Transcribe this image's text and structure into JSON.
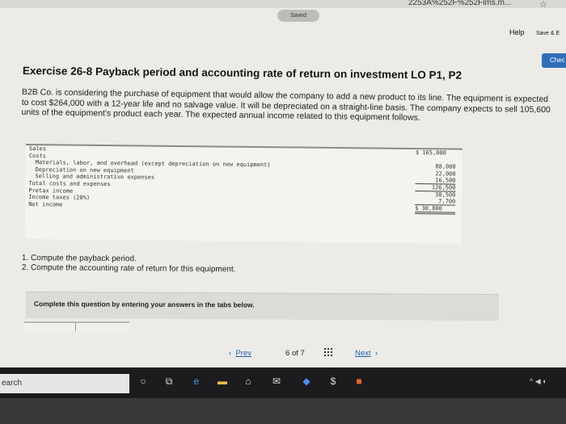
{
  "browser": {
    "url_fragment": "2253A%252F%252Flms.m...",
    "save_exit": "Save & E"
  },
  "header": {
    "saved_label": "Saved",
    "help_label": "Help",
    "check_label": "Chec"
  },
  "exercise": {
    "title": "Exercise 26-8 Payback period and accounting rate of return on investment LO P1, P2",
    "intro": "B2B Co. is considering the purchase of equipment that would allow the company to add a new product to its line. The equipment is expected to cost $264,000 with a 12-year life and no salvage value. It will be depreciated on a straight-line basis. The company expects to sell 105,600 units of the equipment's product each year. The expected annual income related to this equipment follows."
  },
  "income_statement": [
    {
      "label": "Sales",
      "amount": "$ 165,000",
      "indent": false,
      "line": ""
    },
    {
      "label": "Costs",
      "amount": "",
      "indent": false,
      "line": ""
    },
    {
      "label": "Materials, labor, and overhead (except depreciation on new equipment)",
      "amount": "88,000",
      "indent": true,
      "line": ""
    },
    {
      "label": "Depreciation on new equipment",
      "amount": "22,000",
      "indent": true,
      "line": ""
    },
    {
      "label": "Selling and administrative expenses",
      "amount": "16,500",
      "indent": true,
      "line": "under"
    },
    {
      "label": "Total costs and expenses",
      "amount": "126,500",
      "indent": false,
      "line": "under"
    },
    {
      "label": "Pretax income",
      "amount": "38,500",
      "indent": false,
      "line": ""
    },
    {
      "label": "Income taxes (20%)",
      "amount": "7,700",
      "indent": false,
      "line": "under"
    },
    {
      "label": "Net income",
      "amount": "$ 30,800",
      "indent": false,
      "line": "double"
    }
  ],
  "requirements": [
    "1. Compute the payback period.",
    "2. Compute the accounting rate of return for this equipment."
  ],
  "instruction": "Complete this question by entering your answers in the tabs below.",
  "pager": {
    "prev_arrow": "‹",
    "prev_label": "Prev",
    "current": "6",
    "of_word": "of",
    "total": "7",
    "next_label": "Next",
    "next_arrow": "›"
  },
  "taskbar": {
    "search_label": "earch",
    "icons": [
      "cortana-icon",
      "task-view-icon",
      "edge-icon",
      "file-explorer-icon",
      "store-icon",
      "mail-icon",
      "dropbox-icon",
      "dollar-app-icon",
      "office-icon"
    ],
    "tray_icons": "^ ◀ ◐"
  },
  "colors": {
    "accent": "#2f6fb8",
    "link": "#1f5fa8",
    "page_bg": "#ecebe7",
    "taskbar_bg": "#1c1c1e"
  }
}
